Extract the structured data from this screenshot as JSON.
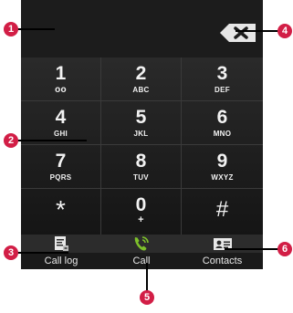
{
  "keys": [
    {
      "digit": "1",
      "letters": "oo"
    },
    {
      "digit": "2",
      "letters": "ABC"
    },
    {
      "digit": "3",
      "letters": "DEF"
    },
    {
      "digit": "4",
      "letters": "GHI"
    },
    {
      "digit": "5",
      "letters": "JKL"
    },
    {
      "digit": "6",
      "letters": "MNO"
    },
    {
      "digit": "7",
      "letters": "PQRS"
    },
    {
      "digit": "8",
      "letters": "TUV"
    },
    {
      "digit": "9",
      "letters": "WXYZ"
    },
    {
      "digit": "*",
      "letters": ""
    },
    {
      "digit": "0",
      "letters": "+"
    },
    {
      "digit": "#",
      "letters": ""
    }
  ],
  "actions": {
    "call_log": "Call log",
    "call": "Call",
    "contacts": "Contacts"
  },
  "callouts": [
    "1",
    "2",
    "3",
    "4",
    "5",
    "6"
  ],
  "colors": {
    "callout": "#d21e46",
    "call_icon": "#7ec12b"
  }
}
